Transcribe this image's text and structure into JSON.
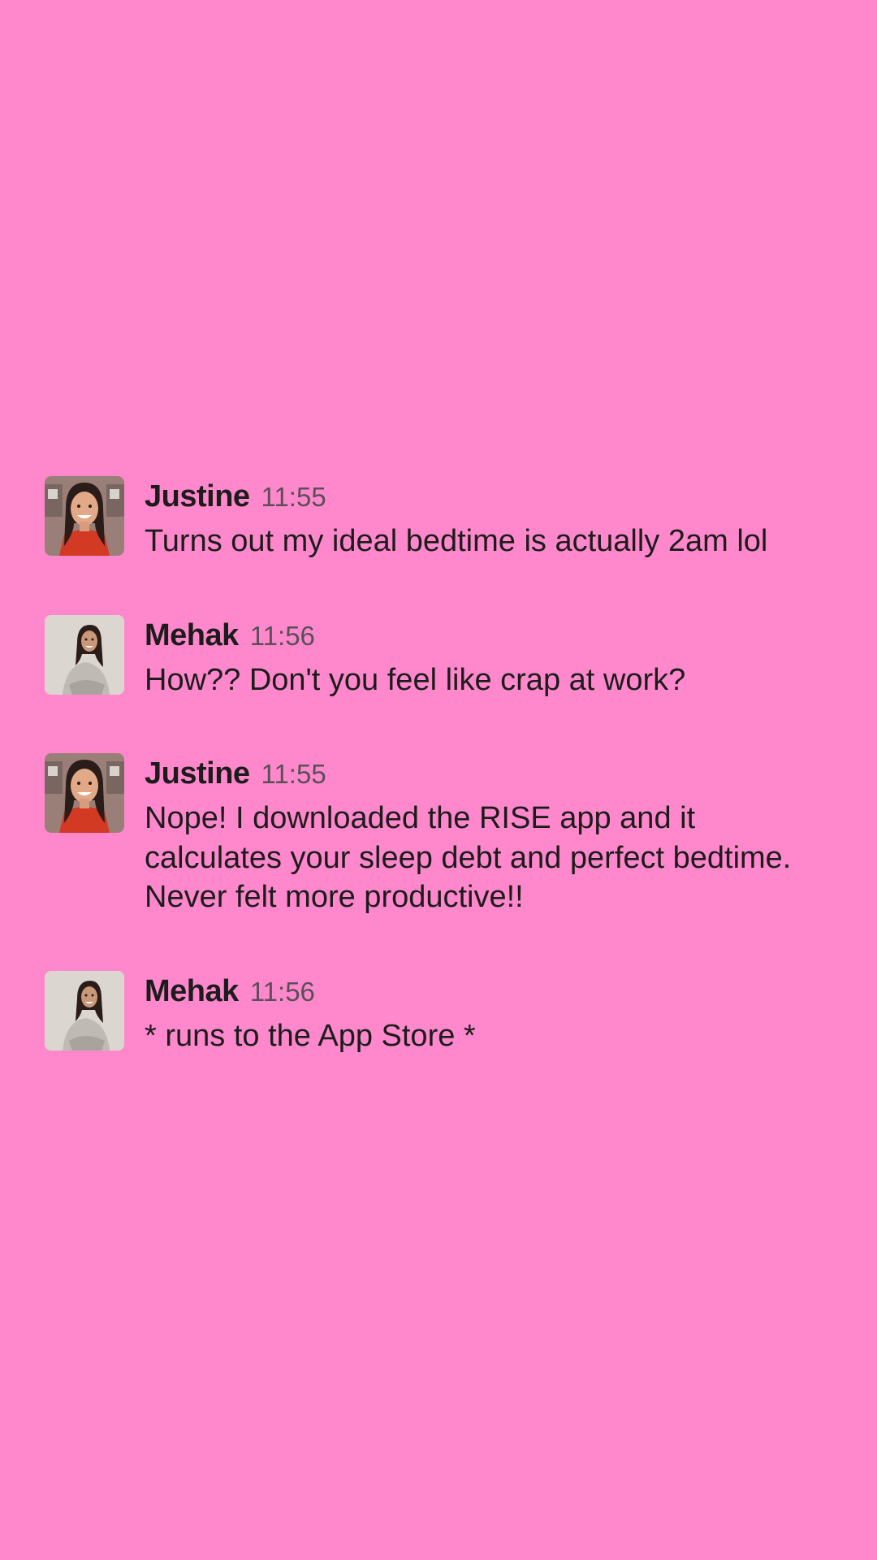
{
  "colors": {
    "background": "#ff88cc",
    "text": "#1d1c1d",
    "timestamp": "#5a4f58"
  },
  "messages": [
    {
      "sender": "Justine",
      "time": "11:55",
      "text": "Turns out my ideal bedtime is actually 2am lol",
      "avatar_icon": "justine-avatar"
    },
    {
      "sender": "Mehak",
      "time": "11:56",
      "text": "How?? Don't you feel like crap at work?",
      "avatar_icon": "mehak-avatar"
    },
    {
      "sender": "Justine",
      "time": "11:55",
      "text": "Nope! I downloaded the RISE app and it\ncalculates your sleep debt and perfect bedtime.\nNever felt more productive!!",
      "avatar_icon": "justine-avatar"
    },
    {
      "sender": "Mehak",
      "time": "11:56",
      "text": "* runs to the App Store *",
      "avatar_icon": "mehak-avatar"
    }
  ]
}
